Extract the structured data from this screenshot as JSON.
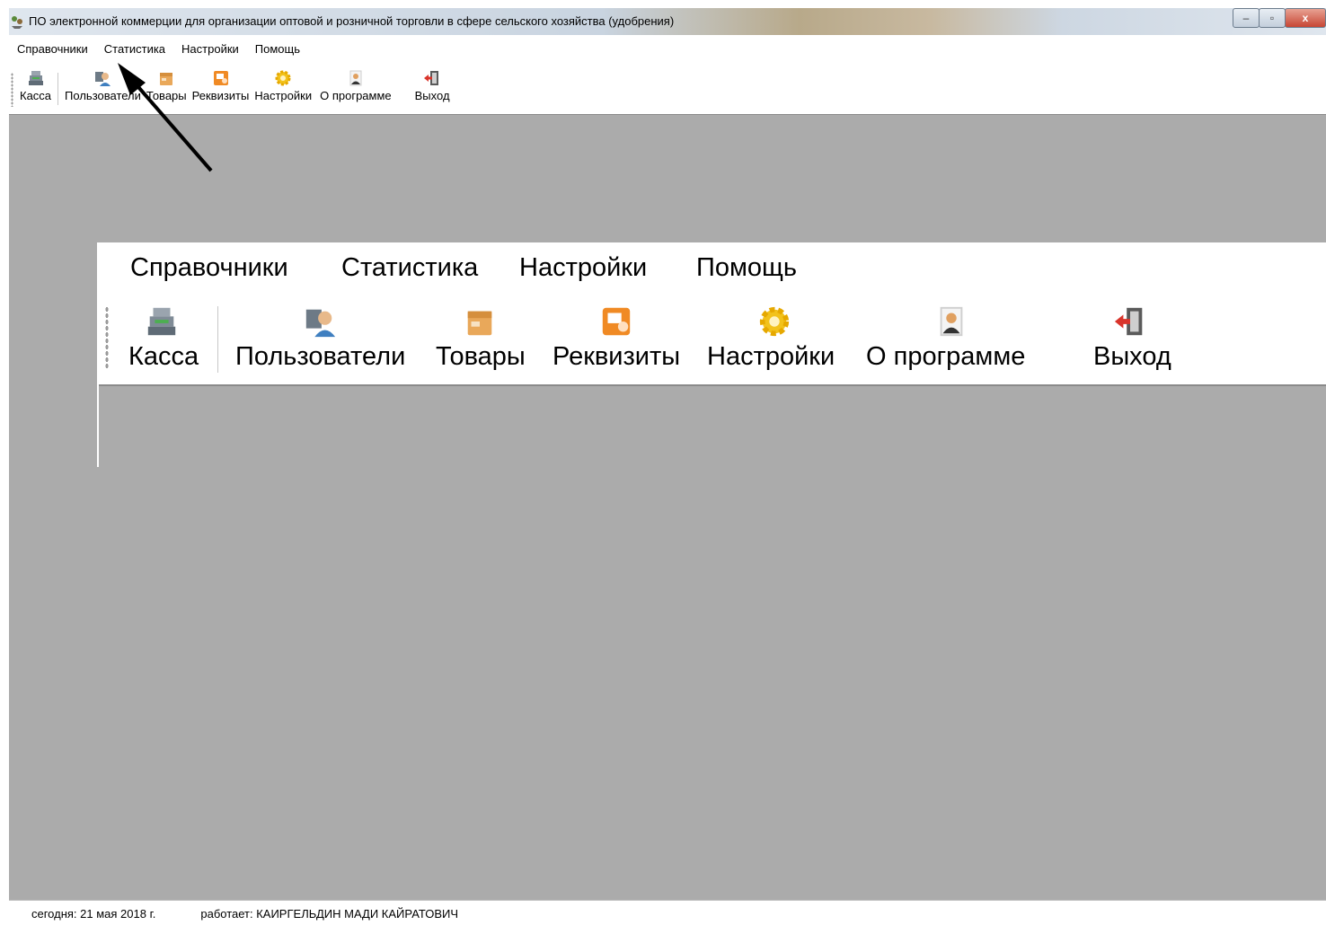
{
  "window": {
    "title": "ПО электронной коммерции для организации оптовой и розничной торговли в сфере сельского хозяйства (удобрения)",
    "minimize_glyph": "–",
    "maximize_glyph": "▫",
    "close_glyph": "x"
  },
  "menu": {
    "items": [
      "Справочники",
      "Статистика",
      "Настройки",
      "Помощь"
    ]
  },
  "toolbar": {
    "buttons": [
      {
        "label": "Касса",
        "icon": "cash-register-icon"
      },
      {
        "label": "Пользователи",
        "icon": "users-icon"
      },
      {
        "label": "Товары",
        "icon": "box-icon"
      },
      {
        "label": "Реквизиты",
        "icon": "details-icon"
      },
      {
        "label": "Настройки",
        "icon": "gear-icon"
      },
      {
        "label": "О программе",
        "icon": "info-person-icon"
      },
      {
        "label": "Выход",
        "icon": "exit-door-icon"
      }
    ]
  },
  "status": {
    "today": "сегодня: 21 мая 2018 г.",
    "user": "работает: КАИРГЕЛЬДИН МАДИ КАЙРАТОВИЧ"
  },
  "colors": {
    "workspace": "#ababab",
    "toolbar_bg": "#ffffff",
    "exit_red": "#d9342b",
    "gear_yellow": "#f2c21b",
    "box_orange": "#e9a85a",
    "details_orange": "#f08a24"
  }
}
